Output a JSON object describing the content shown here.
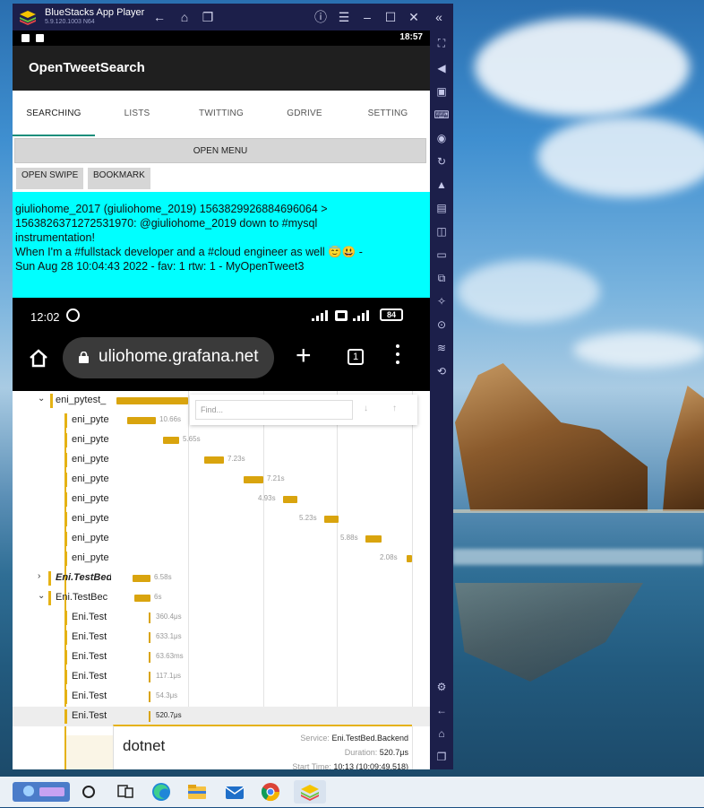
{
  "window": {
    "title": "BlueStacks App Player",
    "version": "5.9.120.1003 N64"
  },
  "android": {
    "status_time": "18:57",
    "app_title": "OpenTweetSearch",
    "tabs": [
      "SEARCHING",
      "LISTS",
      "TWITTING",
      "GDRIVE",
      "SETTING"
    ],
    "active_tab": "SEARCHING",
    "open_menu_label": "OPEN MENU",
    "chips": [
      "OPEN SWIPE",
      "BOOKMARK"
    ],
    "tweet": {
      "line1": "giuliohome_2017 (giuliohome_2019) 1563829926884696064 >",
      "line2": "1563826371272531970: @giuliohome_2019 down to #mysql",
      "line3": "instrumentation!",
      "line4": "When I'm a #fullstack developer and a #cloud engineer as well 😇😃  -",
      "line5": "Sun Aug 28 10:04:43  2022 - fav: 1 rtw: 1 - MyOpenTweet3"
    }
  },
  "phone": {
    "time": "12:02",
    "battery": "84",
    "url": "uliohome.grafana.net",
    "tab_count": "1"
  },
  "trace": {
    "find_placeholder": "Find...",
    "rows": [
      {
        "label": "eni_pytest_",
        "duration": ""
      },
      {
        "label": "eni_pyte",
        "duration": "10.66s"
      },
      {
        "label": "eni_pyte",
        "duration": "5.65s"
      },
      {
        "label": "eni_pyte",
        "duration": "7.23s"
      },
      {
        "label": "eni_pyte",
        "duration": "7.21s"
      },
      {
        "label": "eni_pyte",
        "duration": "4.93s"
      },
      {
        "label": "eni_pyte",
        "duration": "5.23s"
      },
      {
        "label": "eni_pyte",
        "duration": "5.88s"
      },
      {
        "label": "eni_pyte",
        "duration": "2.08s"
      },
      {
        "label": "Eni.TestBed",
        "duration": "6.58s"
      },
      {
        "label": "Eni.TestBec",
        "duration": "6s"
      },
      {
        "label": "Eni.Test",
        "duration": "360.4μs"
      },
      {
        "label": "Eni.Test",
        "duration": "633.1μs"
      },
      {
        "label": "Eni.Test",
        "duration": "63.63ms"
      },
      {
        "label": "Eni.Test",
        "duration": "117.1μs"
      },
      {
        "label": "Eni.Test",
        "duration": "54.3μs"
      },
      {
        "label": "Eni.Test",
        "duration": "520.7μs"
      }
    ],
    "detail": {
      "name": "dotnet",
      "service_label": "Service:",
      "service_value": "Eni.TestBed.Backend",
      "duration_label": "Duration:",
      "duration_value": "520.7μs",
      "start_label": "Start Time:",
      "start_value": "10:13 (10:09:49.518)"
    }
  },
  "colors": {
    "bluestacks_chrome": "#1c1f4a",
    "tweet_bg": "#00ffff",
    "span_color": "#d9a40e",
    "tab_indicator": "#1b8e7c"
  }
}
